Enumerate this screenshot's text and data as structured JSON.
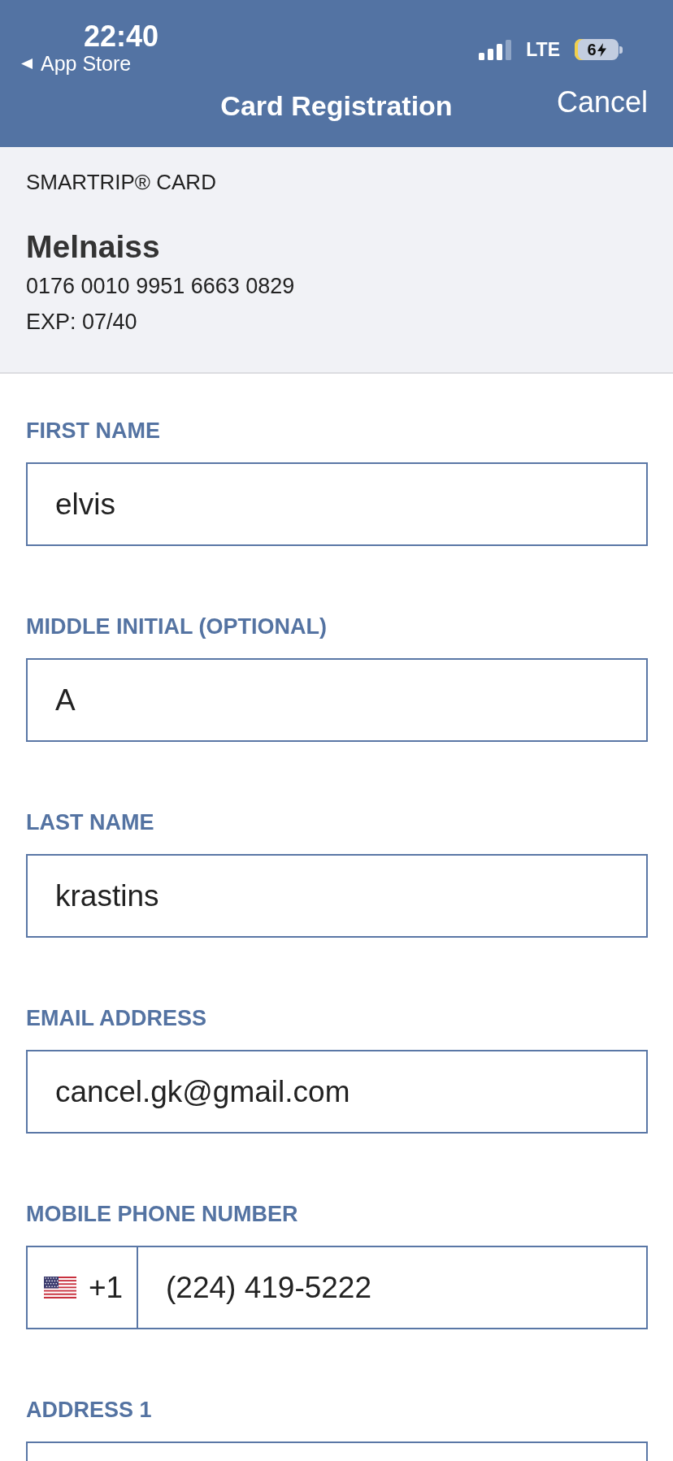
{
  "status_bar": {
    "time": "22:40",
    "back_label": "App Store",
    "network": "LTE",
    "battery_text": "6",
    "charging": true
  },
  "nav": {
    "title": "Card Registration",
    "cancel": "Cancel"
  },
  "card": {
    "heading": "SMARTRIP® CARD",
    "name": "Melnaiss",
    "number": "0176 0010 9951 6663 0829",
    "expiry": "EXP: 07/40"
  },
  "form": {
    "fields": [
      {
        "kind": "text",
        "label": "FIRST NAME",
        "value": "elvis"
      },
      {
        "kind": "text",
        "label": "MIDDLE INITIAL (OPTIONAL)",
        "value": "A"
      },
      {
        "kind": "text",
        "label": "LAST NAME",
        "value": "krastins"
      },
      {
        "kind": "text",
        "label": "EMAIL ADDRESS",
        "value": "cancel.gk@gmail.com"
      },
      {
        "kind": "phone",
        "label": "MOBILE PHONE NUMBER",
        "country_code": "+1",
        "value": "(224) 419-5222"
      },
      {
        "kind": "text",
        "label": "ADDRESS 1"
      }
    ]
  }
}
